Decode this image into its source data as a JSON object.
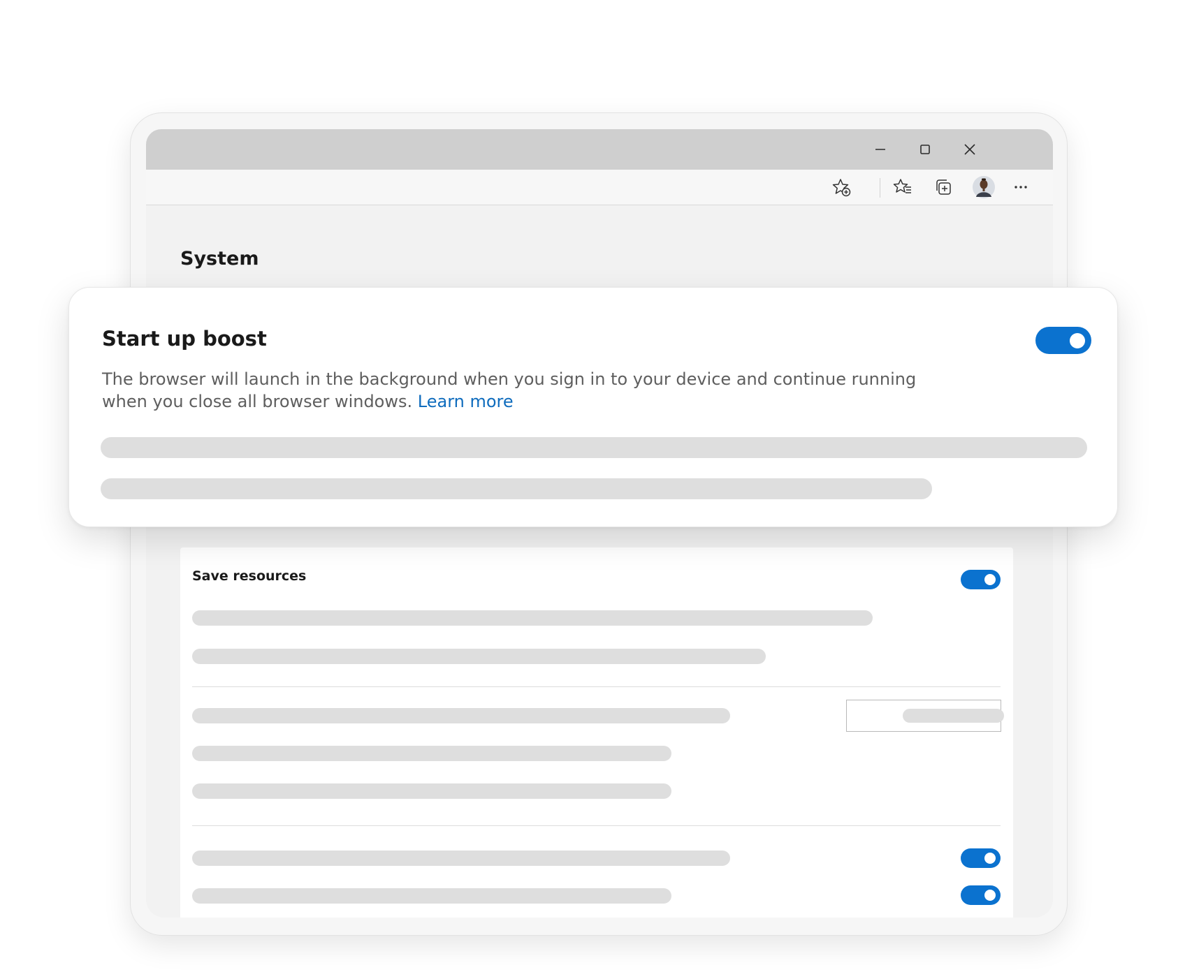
{
  "window_controls": {
    "minimize_icon": "minimize-icon",
    "maximize_icon": "maximize-icon",
    "close_icon": "close-icon"
  },
  "toolbar": {
    "icons": [
      "add-favorite-icon",
      "favorites-icon",
      "collections-icon",
      "profile-avatar",
      "more-options-icon"
    ]
  },
  "page": {
    "title": "System"
  },
  "startup_boost": {
    "title": "Start up boost",
    "description": "The browser will launch in the background when you sign in to your device and continue running when you close all browser windows.",
    "link": "Learn more",
    "toggle_on": true
  },
  "save_resources": {
    "title": "Save resources",
    "toggle_on": true,
    "row_toggles_on": [
      true,
      true
    ]
  },
  "colors": {
    "accent": "#0b72cf",
    "link": "#0f6cbd",
    "placeholder": "#dedede"
  }
}
